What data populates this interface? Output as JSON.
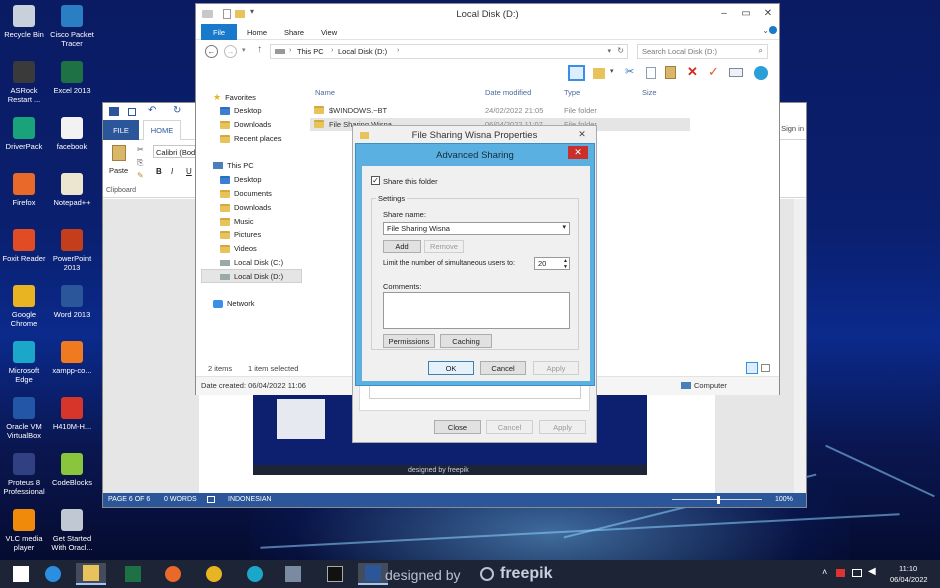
{
  "desktop_icons": [
    {
      "label": "Recycle Bin",
      "icon": "recycle-bin-icon",
      "color": "#c8d0dc"
    },
    {
      "label": "Cisco Packet Tracer",
      "icon": "cisco-icon",
      "color": "#2a7fc4"
    },
    {
      "label": "ASRock Restart ...",
      "icon": "asrock-icon",
      "color": "#3a3a3a"
    },
    {
      "label": "Excel 2013",
      "icon": "excel-icon",
      "color": "#1e7145"
    },
    {
      "label": "DriverPack",
      "icon": "driverpack-icon",
      "color": "#1aa37a"
    },
    {
      "label": "facebook",
      "icon": "file-icon",
      "color": "#f2f2f2"
    },
    {
      "label": "Firefox",
      "icon": "firefox-icon",
      "color": "#e8692a"
    },
    {
      "label": "Notepad++",
      "icon": "notepad-icon",
      "color": "#ece6d0"
    },
    {
      "label": "Foxit Reader",
      "icon": "foxit-icon",
      "color": "#e24c24"
    },
    {
      "label": "PowerPoint 2013",
      "icon": "powerpoint-icon",
      "color": "#c43e1c"
    },
    {
      "label": "Google Chrome",
      "icon": "chrome-icon",
      "color": "#e8b422"
    },
    {
      "label": "Word 2013",
      "icon": "word-icon",
      "color": "#2b579a"
    },
    {
      "label": "Microsoft Edge",
      "icon": "edge-icon",
      "color": "#1ba7c9"
    },
    {
      "label": "xampp-co...",
      "icon": "xampp-icon",
      "color": "#f07a20"
    },
    {
      "label": "Oracle VM VirtualBox",
      "icon": "virtualbox-icon",
      "color": "#2356a6"
    },
    {
      "label": "H410M-H...",
      "icon": "pdf-icon",
      "color": "#d8352a"
    },
    {
      "label": "Proteus 8 Professional",
      "icon": "proteus-icon",
      "color": "#304080"
    },
    {
      "label": "CodeBlocks",
      "icon": "codeblocks-icon",
      "color": "#8ac53e"
    },
    {
      "label": "VLC media player",
      "icon": "vlc-icon",
      "color": "#f08a0a"
    },
    {
      "label": "Get Started With Oracl...",
      "icon": "oracle-icon",
      "color": "#c0c8d4"
    }
  ],
  "explorer": {
    "title": "Local Disk (D:)",
    "tabs": [
      "File",
      "Home",
      "Share",
      "View"
    ],
    "address": [
      "This PC",
      "Local Disk (D:)"
    ],
    "search_placeholder": "Search Local Disk (D:)",
    "tree": [
      "Favorites",
      "Desktop",
      "Downloads",
      "Recent places",
      "This PC",
      "Desktop",
      "Documents",
      "Downloads",
      "Music",
      "Pictures",
      "Videos",
      "Local Disk (C:)",
      "Local Disk (D:)",
      "Network"
    ],
    "columns": [
      "Name",
      "Date modified",
      "Type",
      "Size"
    ],
    "rows": [
      {
        "name": "$WINDOWS.~BT",
        "date": "24/02/2022 21:05",
        "type": "File folder"
      },
      {
        "name": "File Sharing Wisna",
        "date": "06/04/2022 11:07",
        "type": "File folder"
      }
    ],
    "status_items": "2 items",
    "status_selected": "1 item selected",
    "date_created": "Date created: 06/04/2022 11:06",
    "computer": "Computer"
  },
  "word": {
    "tabs": [
      "FILE",
      "HOME"
    ],
    "font": "Calibri (Bod",
    "paste": "Paste",
    "clipboard": "Clipboard",
    "sign_in": "Sign in",
    "status": [
      "PAGE 6 OF 6",
      "0 WORDS",
      "INDONESIAN"
    ],
    "zoom": "100%"
  },
  "properties": {
    "title": "File Sharing Wisna Properties",
    "close": "Close",
    "cancel": "Cancel",
    "apply": "Apply"
  },
  "advanced": {
    "title": "Advanced Sharing",
    "share_checkbox": "Share this folder",
    "settings": "Settings",
    "share_name_label": "Share name:",
    "share_name": "File Sharing Wisna",
    "add": "Add",
    "remove": "Remove",
    "limit_label": "Limit the number of simultaneous users to:",
    "limit_value": "20",
    "comments": "Comments:",
    "permissions": "Permissions",
    "caching": "Caching",
    "ok": "OK",
    "cancel": "Cancel",
    "apply": "Apply"
  },
  "embedded_shot": {
    "watermark": "designed by freepik"
  },
  "taskbar": {
    "time": "11:10",
    "date": "06/04/2022",
    "watermark": "designed by",
    "watermark2": "freepik",
    "apps": [
      {
        "icon": "start-icon"
      },
      {
        "icon": "ie-icon"
      },
      {
        "icon": "file-explorer-icon"
      },
      {
        "icon": "excel-icon"
      },
      {
        "icon": "firefox-icon"
      },
      {
        "icon": "chrome-icon"
      },
      {
        "icon": "edge-icon"
      },
      {
        "icon": "network-icon"
      },
      {
        "icon": "cmd-icon"
      },
      {
        "icon": "word-icon"
      }
    ]
  }
}
